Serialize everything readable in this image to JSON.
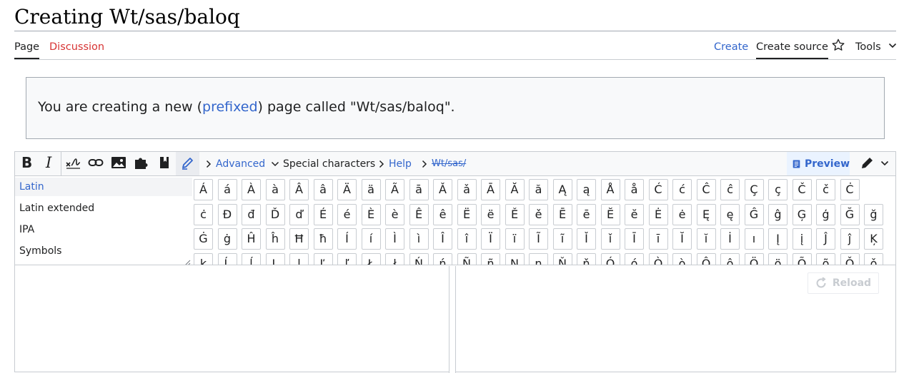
{
  "page": {
    "title": "Creating Wt/sas/baloq"
  },
  "tabs": {
    "page": "Page",
    "discussion": "Discussion",
    "create": "Create",
    "create_source": "Create source",
    "tools": "Tools"
  },
  "notice": {
    "before": "You are creating a new (",
    "link": "prefixed",
    "after": ") page called \"Wt/sas/baloq\"."
  },
  "toolbar": {
    "advanced": "Advanced",
    "special_characters": "Special characters",
    "help": "Help",
    "breadcrumb": "Wt/sas/",
    "preview": "Preview"
  },
  "special_characters": {
    "categories": [
      "Latin",
      "Latin extended",
      "IPA",
      "Symbols"
    ],
    "active_category": "Latin",
    "characters": [
      [
        "Á",
        "á",
        "À",
        "à",
        "Â",
        "â",
        "Ä",
        "ä",
        "Ã",
        "ā",
        "Ǎ",
        "ǎ",
        "Ā",
        "Ă",
        "ă",
        "Ą",
        "ą",
        "Å",
        "å",
        "Ć",
        "ć",
        "Ĉ",
        "ĉ",
        "Ç",
        "ç",
        "Č",
        "č",
        "Ċ"
      ],
      [
        "ċ",
        "Đ",
        "đ",
        "Ď",
        "ď",
        "É",
        "é",
        "È",
        "è",
        "Ê",
        "ê",
        "Ë",
        "ë",
        "Ě",
        "ě",
        "Ē",
        "ē",
        "Ĕ",
        "ĕ",
        "Ė",
        "ė",
        "Ę",
        "ę",
        "Ĝ",
        "ĝ",
        "Ģ",
        "ģ",
        "Ğ",
        "ğ"
      ],
      [
        "Ġ",
        "ġ",
        "Ĥ",
        "ĥ",
        "Ħ",
        "ħ",
        "Í",
        "í",
        "Ì",
        "ì",
        "Î",
        "î",
        "Ï",
        "ï",
        "Ĩ",
        "ĩ",
        "Ǐ",
        "ǐ",
        "Ī",
        "ī",
        "Ĭ",
        "ĭ",
        "İ",
        "ı",
        "Į",
        "į",
        "Ĵ",
        "ĵ",
        "Ķ"
      ],
      [
        "ķ",
        "Ĺ",
        "ĺ",
        "Ļ",
        "ļ",
        "Ľ",
        "ľ",
        "Ł",
        "ł",
        "Ń",
        "ń",
        "Ñ",
        "ñ",
        "Ņ",
        "ņ",
        "Ň",
        "ň",
        "Ó",
        "ó",
        "Ò",
        "ò",
        "Ô",
        "ô",
        "Ö",
        "ö",
        "Õ",
        "õ",
        "Ǒ",
        "ǒ"
      ]
    ]
  },
  "preview_pane": {
    "reload": "Reload"
  },
  "colors": {
    "link": "#3366cc",
    "red_link": "#d73333",
    "border": "#c8ccd1"
  }
}
